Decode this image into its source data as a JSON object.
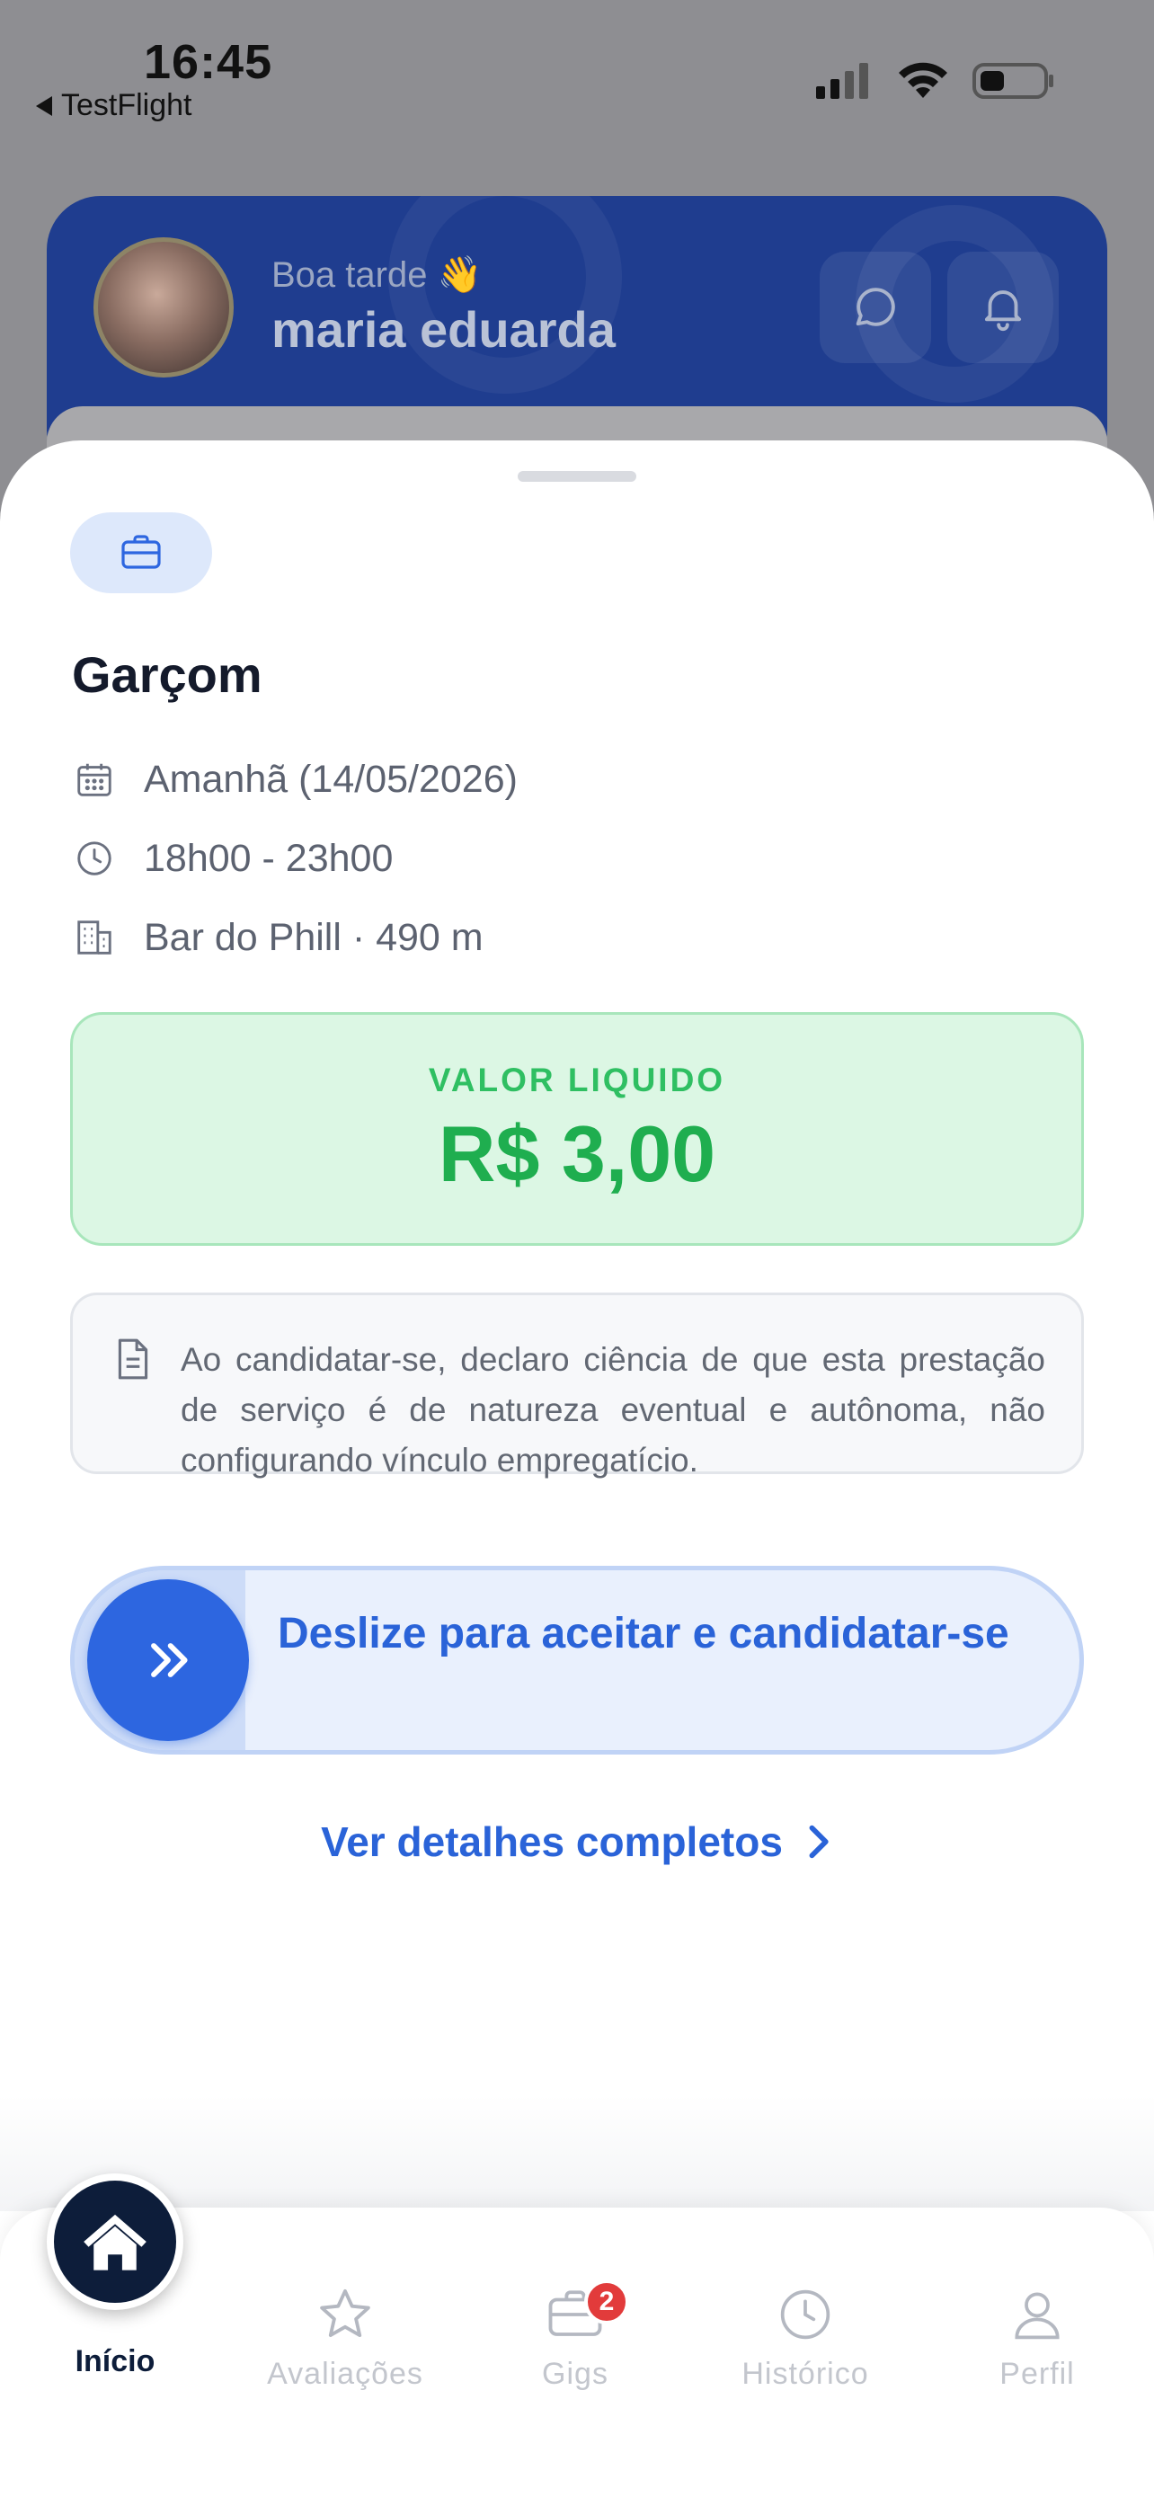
{
  "status_bar": {
    "time": "16:45",
    "back_app": "TestFlight"
  },
  "header": {
    "greeting": "Boa tarde 👋",
    "user_name": "maria eduarda"
  },
  "job": {
    "title": "Garçom",
    "date": "Amanhã (14/05/2026)",
    "time": "18h00 - 23h00",
    "place": "Bar do Phill · 490 m",
    "value_label": "VALOR LIQUIDO",
    "value_amount": "R$ 3,00",
    "notice": "Ao candidatar-se, declaro ciência de que esta prestação de serviço é de natureza eventual e autônoma, não configurando vínculo empregatício.",
    "slider_label": "Deslize para aceitar e candidatar-se",
    "details_link": "Ver detalhes completos"
  },
  "tabbar": {
    "home": "Início",
    "reviews": "Avaliações",
    "gigs": "Gigs",
    "gigs_badge": "2",
    "history": "Histórico",
    "profile": "Perfil"
  },
  "colors": {
    "accent": "#2d66e0",
    "success": "#1fae4f",
    "navy": "#0d1d3a",
    "badge": "#e23b3b"
  }
}
